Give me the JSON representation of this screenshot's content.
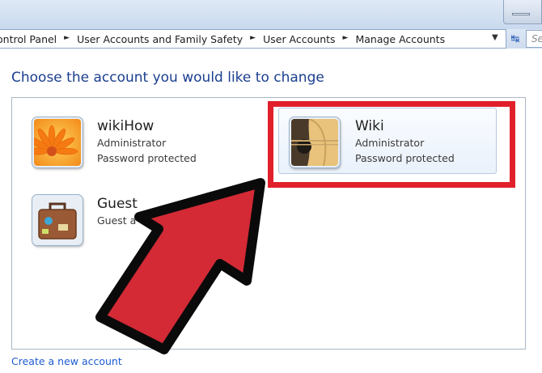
{
  "window": {
    "minimize_icon": "minimize-icon"
  },
  "address_bar": {
    "breadcrumbs": [
      "ontrol Panel",
      "User Accounts and Family Safety",
      "User Accounts",
      "Manage Accounts"
    ],
    "search_placeholder": "Se"
  },
  "page": {
    "heading": "Choose the account you would like to change"
  },
  "accounts": [
    {
      "name": "wikiHow",
      "role": "Administrator",
      "status": "Password protected",
      "picture": "flower-picture"
    },
    {
      "name": "Wiki",
      "role": "Administrator",
      "status": "Password protected",
      "picture": "guitar-picture"
    },
    {
      "name": "Guest",
      "role": "Guest a",
      "status": "",
      "picture": "suitcase-picture"
    }
  ],
  "footer": {
    "create_link": "Create a new account"
  },
  "highlight": {
    "box_color": "#e0202a",
    "arrow_color": "#d32a36"
  }
}
